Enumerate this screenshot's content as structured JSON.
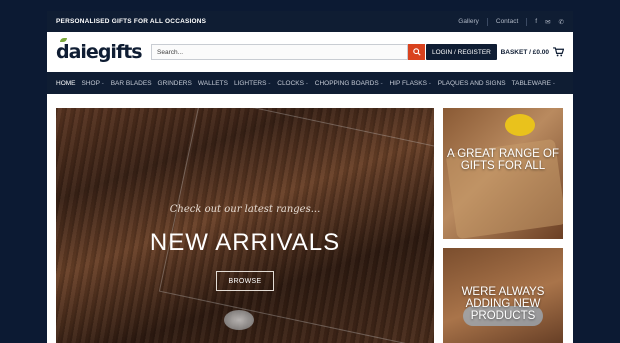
{
  "topbar": {
    "tagline": "PERSONALISED GIFTS FOR ALL OCCASIONS",
    "gallery": "Gallery",
    "contact": "Contact",
    "icons": [
      "facebook-icon",
      "email-icon",
      "phone-icon"
    ]
  },
  "header": {
    "logo_part1": "daie",
    "logo_part2": "gifts",
    "search_placeholder": "Search...",
    "login_label": "LOGIN / REGISTER",
    "basket_label": "BASKET / £0.00"
  },
  "nav": {
    "items": [
      {
        "label": "HOME",
        "dropdown": false,
        "active": true
      },
      {
        "label": "SHOP",
        "dropdown": true
      },
      {
        "label": "BAR BLADES",
        "dropdown": false
      },
      {
        "label": "GRINDERS",
        "dropdown": false
      },
      {
        "label": "WALLETS",
        "dropdown": false
      },
      {
        "label": "LIGHTERS",
        "dropdown": true
      },
      {
        "label": "CLOCKS",
        "dropdown": true
      },
      {
        "label": "CHOPPING BOARDS",
        "dropdown": true
      },
      {
        "label": "HIP FLASKS",
        "dropdown": true
      },
      {
        "label": "PLAQUES AND SIGNS",
        "dropdown": false
      },
      {
        "label": "TABLEWARE",
        "dropdown": true
      }
    ]
  },
  "hero": {
    "tagline": "Check out our latest ranges...",
    "title": "NEW ARRIVALS",
    "button": "BROWSE"
  },
  "side_banners": [
    {
      "caption": "A GREAT RANGE OF GIFTS FOR ALL"
    },
    {
      "caption": "WERE ALWAYS ADDING NEW PRODUCTS"
    }
  ],
  "colors": {
    "navy": "#0f1d33",
    "accent": "#d9421e",
    "background": "#0c1a33"
  }
}
